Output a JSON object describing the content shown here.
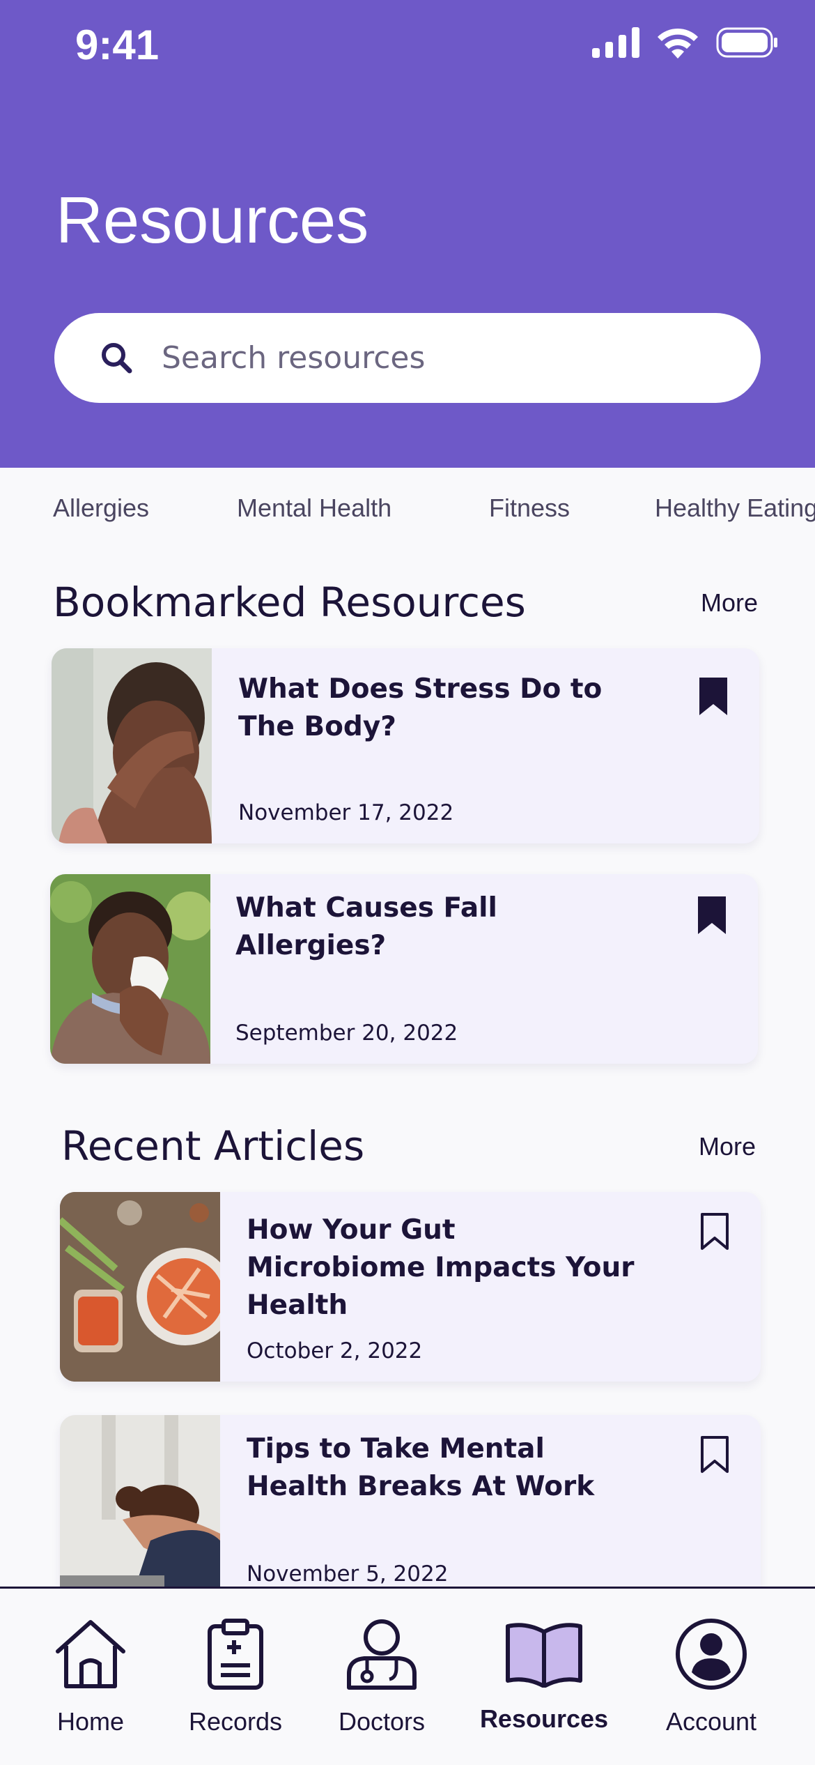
{
  "status_bar": {
    "time": "9:41"
  },
  "header": {
    "title": "Resources",
    "search_placeholder": "Search resources"
  },
  "categories": [
    "Allergies",
    "Mental Health",
    "Fitness",
    "Healthy Eating"
  ],
  "bookmarked": {
    "title": "Bookmarked Resources",
    "more_label": "More",
    "items": [
      {
        "title": "What Does Stress Do to The Body?",
        "date": "November 17, 2022",
        "bookmarked": true
      },
      {
        "title": "What Causes Fall Allergies?",
        "date": "September 20, 2022",
        "bookmarked": true
      }
    ]
  },
  "recent": {
    "title": "Recent Articles",
    "more_label": "More",
    "items": [
      {
        "title": "How Your Gut Microbiome Impacts Your Health",
        "date": "October 2, 2022",
        "bookmarked": false
      },
      {
        "title": "Tips to Take Mental Health Breaks At Work",
        "date": "November 5, 2022",
        "bookmarked": false
      }
    ]
  },
  "tabbar": {
    "items": [
      {
        "label": "Home",
        "icon": "home-icon"
      },
      {
        "label": "Records",
        "icon": "clipboard-icon"
      },
      {
        "label": "Doctors",
        "icon": "doctor-icon"
      },
      {
        "label": "Resources",
        "icon": "book-icon",
        "active": true
      },
      {
        "label": "Account",
        "icon": "account-icon"
      }
    ]
  },
  "colors": {
    "header_bg": "#6e59c8",
    "card_bg": "#f3f1fc",
    "text_dark": "#1c1438",
    "active_icon_fill": "#c8b8ec"
  }
}
